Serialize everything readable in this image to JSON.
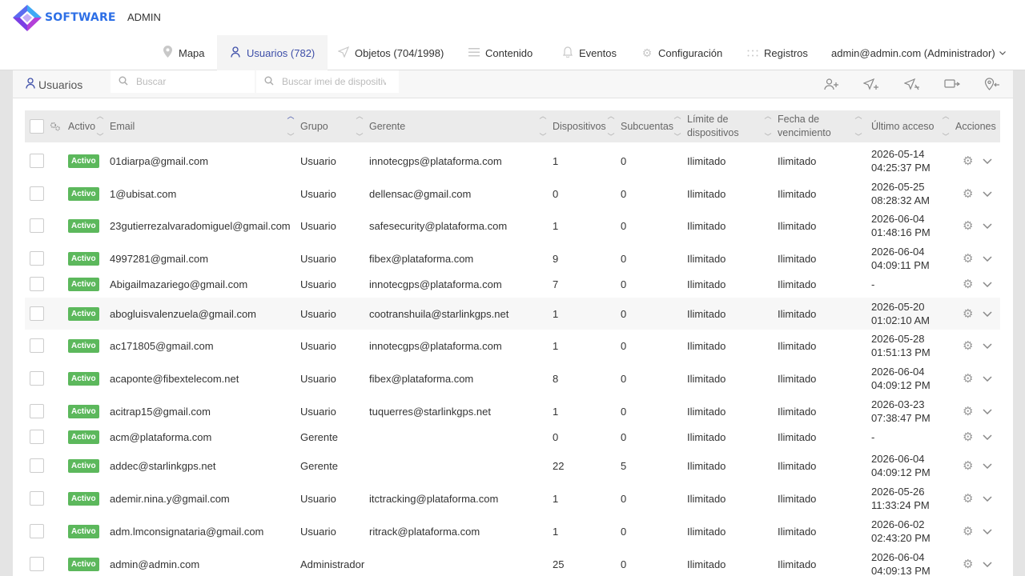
{
  "brand": {
    "logo_text": "SOFTWARE",
    "primary_color": "#3d4ea8",
    "active_badge_color": "#5cb85c"
  },
  "header": {
    "section_label": "ADMIN"
  },
  "nav": {
    "items": [
      {
        "label": "Mapa",
        "icon": "map-pin-icon"
      },
      {
        "label": "Usuarios (782)",
        "icon": "user-icon",
        "active": true
      },
      {
        "label": "Objetos (704/1998)",
        "icon": "send-icon"
      },
      {
        "label": "Contenido",
        "icon": "menu-lines-icon"
      },
      {
        "label": "Eventos",
        "icon": "bell-icon"
      },
      {
        "label": "Configuración",
        "icon": "gear-icon"
      },
      {
        "label": "Registros",
        "icon": "dots-grid-icon"
      }
    ],
    "user": "admin@admin.com (Administrador)"
  },
  "panel": {
    "title": "Usuarios",
    "search_placeholder": "Buscar",
    "imei_placeholder": "Buscar imei de dispositivo",
    "tools": [
      "add-user-icon",
      "send-plus-icon",
      "send-minus-icon",
      "message-icon",
      "location-icon"
    ]
  },
  "table": {
    "headers": {
      "activo": "Activo",
      "email": "Email",
      "grupo": "Grupo",
      "gerente": "Gerente",
      "dispositivos": "Dispositivos",
      "subcuentas": "Subcuentas",
      "limite_1": "Límite de",
      "limite_2": "dispositivos",
      "fecha_1": "Fecha de",
      "fecha_2": "vencimiento",
      "ultimo": "Último acceso",
      "acciones": "Acciones"
    },
    "rows": [
      {
        "status": "Activo",
        "email": "01diarpa@gmail.com",
        "grupo": "Usuario",
        "gerente": "innotecgps@plataforma.com",
        "dispositivos": "1",
        "subcuentas": "0",
        "limite": "Ilimitado",
        "vencimiento": "Ilimitado",
        "acceso_fecha": "2026-05-14",
        "acceso_hora": "04:25:37 PM"
      },
      {
        "status": "Activo",
        "email": "1@ubisat.com",
        "grupo": "Usuario",
        "gerente": "dellensac@gmail.com",
        "dispositivos": "0",
        "subcuentas": "0",
        "limite": "Ilimitado",
        "vencimiento": "Ilimitado",
        "acceso_fecha": "2026-05-25",
        "acceso_hora": "08:28:32 AM"
      },
      {
        "status": "Activo",
        "email": "23gutierrezalvaradomiguel@gmail.com",
        "grupo": "Usuario",
        "gerente": "safesecurity@plataforma.com",
        "dispositivos": "1",
        "subcuentas": "0",
        "limite": "Ilimitado",
        "vencimiento": "Ilimitado",
        "acceso_fecha": "2026-06-04",
        "acceso_hora": "01:48:16 PM"
      },
      {
        "status": "Activo",
        "email": "4997281@gmail.com",
        "grupo": "Usuario",
        "gerente": "fibex@plataforma.com",
        "dispositivos": "9",
        "subcuentas": "0",
        "limite": "Ilimitado",
        "vencimiento": "Ilimitado",
        "acceso_fecha": "2026-06-04",
        "acceso_hora": "04:09:11 PM"
      },
      {
        "status": "Activo",
        "email": "Abigailmazariego@gmail.com",
        "grupo": "Usuario",
        "gerente": "innotecgps@plataforma.com",
        "dispositivos": "7",
        "subcuentas": "0",
        "limite": "Ilimitado",
        "vencimiento": "Ilimitado",
        "acceso_fecha": "-",
        "acceso_hora": ""
      },
      {
        "status": "Activo",
        "email": "abogluisvalenzuela@gmail.com",
        "grupo": "Usuario",
        "gerente": "cootranshuila@starlinkgps.net",
        "dispositivos": "1",
        "subcuentas": "0",
        "limite": "Ilimitado",
        "vencimiento": "Ilimitado",
        "acceso_fecha": "2026-05-20",
        "acceso_hora": "01:02:10 AM"
      },
      {
        "status": "Activo",
        "email": "ac171805@gmail.com",
        "grupo": "Usuario",
        "gerente": "innotecgps@plataforma.com",
        "dispositivos": "1",
        "subcuentas": "0",
        "limite": "Ilimitado",
        "vencimiento": "Ilimitado",
        "acceso_fecha": "2026-05-28",
        "acceso_hora": "01:51:13 PM"
      },
      {
        "status": "Activo",
        "email": "acaponte@fibextelecom.net",
        "grupo": "Usuario",
        "gerente": "fibex@plataforma.com",
        "dispositivos": "8",
        "subcuentas": "0",
        "limite": "Ilimitado",
        "vencimiento": "Ilimitado",
        "acceso_fecha": "2026-06-04",
        "acceso_hora": "04:09:12 PM"
      },
      {
        "status": "Activo",
        "email": "acitrap15@gmail.com",
        "grupo": "Usuario",
        "gerente": "tuquerres@starlinkgps.net",
        "dispositivos": "1",
        "subcuentas": "0",
        "limite": "Ilimitado",
        "vencimiento": "Ilimitado",
        "acceso_fecha": "2026-03-23",
        "acceso_hora": "07:38:47 PM"
      },
      {
        "status": "Activo",
        "email": "acm@plataforma.com",
        "grupo": "Gerente",
        "gerente": "",
        "dispositivos": "0",
        "subcuentas": "0",
        "limite": "Ilimitado",
        "vencimiento": "Ilimitado",
        "acceso_fecha": "-",
        "acceso_hora": ""
      },
      {
        "status": "Activo",
        "email": "addec@starlinkgps.net",
        "grupo": "Gerente",
        "gerente": "",
        "dispositivos": "22",
        "subcuentas": "5",
        "limite": "Ilimitado",
        "vencimiento": "Ilimitado",
        "acceso_fecha": "2026-06-04",
        "acceso_hora": "04:09:12 PM"
      },
      {
        "status": "Activo",
        "email": "ademir.nina.y@gmail.com",
        "grupo": "Usuario",
        "gerente": "itctracking@plataforma.com",
        "dispositivos": "1",
        "subcuentas": "0",
        "limite": "Ilimitado",
        "vencimiento": "Ilimitado",
        "acceso_fecha": "2026-05-26",
        "acceso_hora": "11:33:24 PM"
      },
      {
        "status": "Activo",
        "email": "adm.lmconsignataria@gmail.com",
        "grupo": "Usuario",
        "gerente": "ritrack@plataforma.com",
        "dispositivos": "1",
        "subcuentas": "0",
        "limite": "Ilimitado",
        "vencimiento": "Ilimitado",
        "acceso_fecha": "2026-06-02",
        "acceso_hora": "02:43:20 PM"
      },
      {
        "status": "Activo",
        "email": "admin@admin.com",
        "grupo": "Administrador",
        "gerente": "",
        "dispositivos": "25",
        "subcuentas": "0",
        "limite": "Ilimitado",
        "vencimiento": "Ilimitado",
        "acceso_fecha": "2026-06-04",
        "acceso_hora": "04:09:13 PM"
      }
    ]
  }
}
